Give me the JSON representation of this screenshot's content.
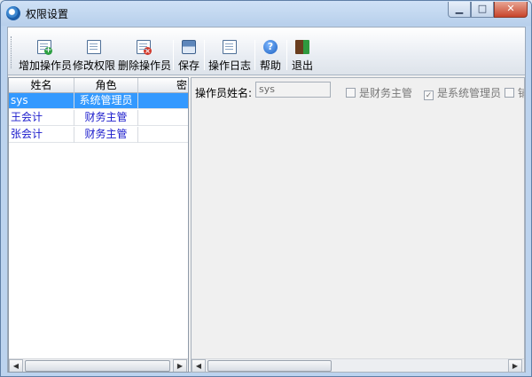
{
  "window": {
    "title": "权限设置",
    "minimize_glyph": "▁",
    "maximize_glyph": "□",
    "close_glyph": "✕"
  },
  "toolbar": {
    "buttons": [
      {
        "label": "增加操作员",
        "icon": "add-user-icon"
      },
      {
        "label": "修改权限",
        "icon": "edit-permission-icon"
      },
      {
        "label": "删除操作员",
        "icon": "delete-user-icon"
      },
      {
        "label": "保存",
        "icon": "save-icon"
      },
      {
        "label": "操作日志",
        "icon": "log-icon"
      },
      {
        "label": "帮助",
        "icon": "help-icon"
      },
      {
        "label": "退出",
        "icon": "exit-icon"
      }
    ],
    "help_glyph": "?"
  },
  "operator_grid": {
    "columns": [
      "姓名",
      "角色",
      "密"
    ],
    "rows": [
      {
        "name": "sys",
        "role": "系统管理员",
        "selected": true
      },
      {
        "name": "王会计",
        "role": "财务主管",
        "selected": false
      },
      {
        "name": "张会计",
        "role": "财务主管",
        "selected": false
      }
    ]
  },
  "detail": {
    "operator_name_label": "操作员姓名:",
    "operator_name_value": "sys",
    "checkboxes": [
      {
        "label": "是财务主管",
        "checked": false
      },
      {
        "label": "是系统管理员",
        "checked": true
      },
      {
        "label": "铺",
        "checked": false
      }
    ],
    "check_glyph": "✓"
  },
  "scroll": {
    "left_arrow": "◀",
    "right_arrow": "▶"
  },
  "colors": {
    "selection": "#3399ff",
    "row_text": "#1a1acc",
    "close_button": "#c7442a"
  }
}
